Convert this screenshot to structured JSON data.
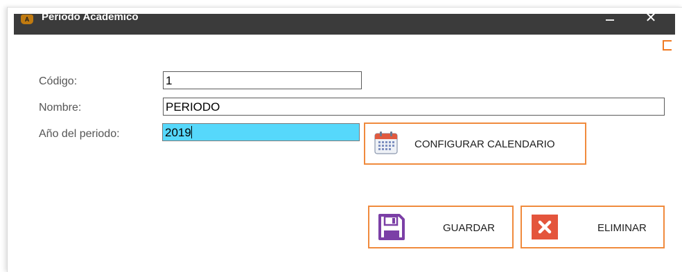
{
  "window": {
    "title": "Periodo Academico",
    "app_icon_text": "A",
    "minimize_glyph": "–",
    "close_glyph": "✕"
  },
  "form": {
    "codigo_label": "Código:",
    "codigo_value": "1",
    "nombre_label": "Nombre:",
    "nombre_value": "PERIODO",
    "anio_label": "Año del periodo:",
    "anio_value": "2019"
  },
  "buttons": {
    "configurar_calendario": "CONFIGURAR CALENDARIO",
    "guardar": "GUARDAR",
    "eliminar": "ELIMINAR"
  },
  "colors": {
    "titlebar": "#3b3b3b",
    "accent_border": "#f08a3c",
    "active_field": "#56d8fb",
    "delete_icon": "#e4553c",
    "save_icon": "#7b3fa6"
  },
  "icons": [
    "app-icon",
    "minimize-icon",
    "close-icon",
    "calendar-icon",
    "floppy-disk-icon",
    "delete-x-icon"
  ]
}
